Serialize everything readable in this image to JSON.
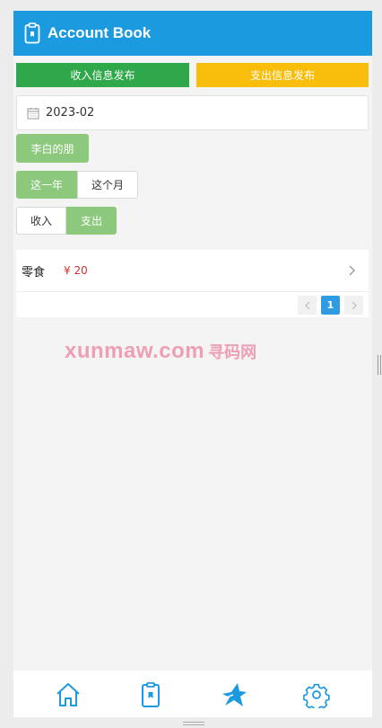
{
  "app": {
    "title": "Account Book"
  },
  "publish": {
    "income_label": "收入信息发布",
    "expense_label": "支出信息发布"
  },
  "date_filter": {
    "value": "2023-02"
  },
  "user": {
    "name": "李白的朋"
  },
  "period_tabs": [
    {
      "label": "这一年",
      "active": true
    },
    {
      "label": "这个月",
      "active": false
    }
  ],
  "type_tabs": [
    {
      "label": "收入",
      "active": false
    },
    {
      "label": "支出",
      "active": true
    }
  ],
  "records": [
    {
      "category": "零食",
      "amount": "¥ 20"
    }
  ],
  "pagination": {
    "current": "1"
  },
  "watermark": {
    "text": "xunmaw.com",
    "cn": "寻码网"
  },
  "tabbar": {
    "items": [
      "home-icon",
      "clipboard-icon",
      "star-icon",
      "settings-icon"
    ]
  },
  "colors": {
    "header": "#1b9ae0",
    "income": "#2ea84a",
    "expense": "#f9bd0b",
    "active_green": "#8cc97c",
    "amount_red": "#d42f2f",
    "page_active": "#2f9be4"
  }
}
